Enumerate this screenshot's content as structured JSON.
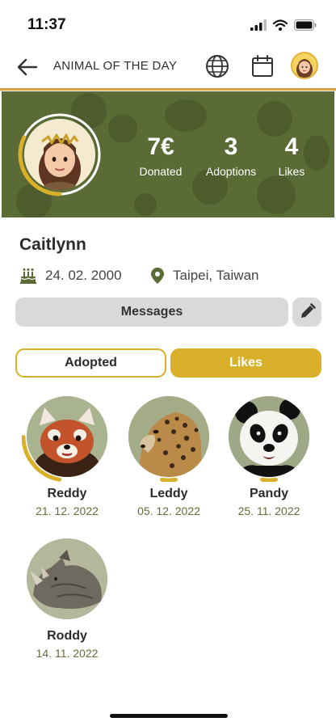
{
  "status_bar": {
    "time": "11:37"
  },
  "nav": {
    "title": "ANIMAL OF THE DAY"
  },
  "profile": {
    "name": "Caitlynn",
    "birthday": "24. 02. 2000",
    "location": "Taipei, Taiwan",
    "avatar_progress": 0.32
  },
  "stats": [
    {
      "value": "7€",
      "label": "Donated"
    },
    {
      "value": "3",
      "label": "Adoptions"
    },
    {
      "value": "4",
      "label": "Likes"
    }
  ],
  "actions": {
    "messages_label": "Messages"
  },
  "tabs": [
    {
      "label": "Adopted",
      "active": false
    },
    {
      "label": "Likes",
      "active": true
    }
  ],
  "animals": [
    {
      "name": "Reddy",
      "date": "21. 12. 2022",
      "progress": 0.22,
      "icon": "red-panda"
    },
    {
      "name": "Leddy",
      "date": "05. 12. 2022",
      "progress": 0.05,
      "icon": "leopard"
    },
    {
      "name": "Pandy",
      "date": "25. 11. 2022",
      "progress": 0.05,
      "icon": "giant-panda"
    },
    {
      "name": "Roddy",
      "date": "14. 11. 2022",
      "progress": 0,
      "icon": "rhinoceros"
    }
  ],
  "colors": {
    "banner": "#5a6b35",
    "accent": "#d8b02a",
    "divider": "#d9a441",
    "button_gray": "#d9d9d9",
    "date_text": "#6a6a3a"
  }
}
